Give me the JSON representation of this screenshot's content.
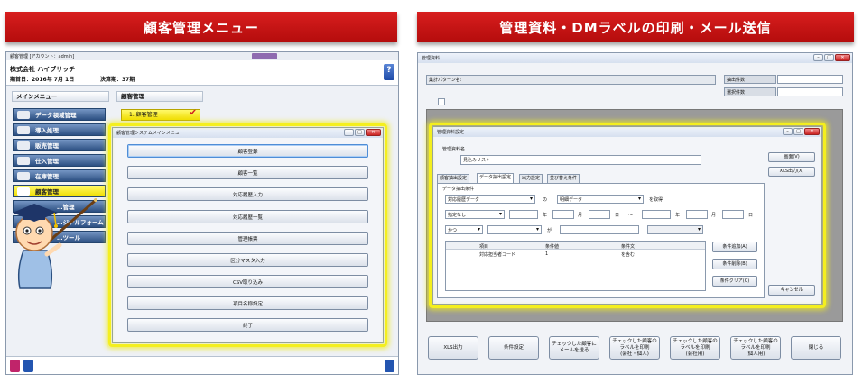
{
  "left": {
    "banner": "顧客管理メニュー",
    "window": {
      "title": "顧客管理 [アカウント：admin]",
      "company": "株式会社 ハイブリッチ",
      "period_start": "期首日：2016年 7月 1日",
      "fiscal_period": "決算期：37期",
      "help": "?",
      "main_menu_label": "メインメニュー",
      "sidebar": [
        {
          "label": "データ領域管理",
          "icon": "□"
        },
        {
          "label": "導入処理",
          "icon": "□"
        },
        {
          "label": "販売管理",
          "icon": "□"
        },
        {
          "label": "仕入管理",
          "icon": "□"
        },
        {
          "label": "在庫管理",
          "icon": "□"
        },
        {
          "label": "顧客管理",
          "icon": "□"
        },
        {
          "label": "…管理",
          "icon": ""
        },
        {
          "label": "…ジナルフォーム",
          "icon": ""
        },
        {
          "label": "…ツール",
          "icon": ""
        }
      ],
      "section_title": "顧客管理",
      "sub_item": "1. 顧客管理",
      "check": "✔"
    },
    "dialog": {
      "title": "顧客管理システムメインメニュー",
      "buttons": [
        "顧客登録",
        "顧客一覧",
        "対応履歴入力",
        "対応履歴一覧",
        "管理帳票",
        "区分マスタ入力",
        "CSV取り込み",
        "項目名称設定",
        "終了"
      ]
    }
  },
  "right": {
    "banner": "管理資料・DMラベルの印刷・メール送信",
    "window": {
      "title": "管理資料",
      "pattern_label": "集計パターン名:",
      "extract_label": "抽出件数",
      "select_label": "選択件数"
    },
    "dialog": {
      "title": "管理資料設定",
      "name_label": "管理資料名",
      "name_value": "見込みリスト",
      "tabs": [
        "顧客抽出設定",
        "データ抽出設定",
        "出力設定",
        "並び替え条件"
      ],
      "active_tab": 1,
      "group_label": "データ抽出条件",
      "sel1": "対応履歴データ",
      "no": "の",
      "sel2": "明細データ",
      "wo_get": "を取得",
      "sel3": "指定なし",
      "date_labels": [
        "年",
        "月",
        "日",
        "～",
        "年",
        "月",
        "日"
      ],
      "and_sel": "かつ",
      "ga": "が",
      "table_headers": [
        "項目",
        "条件値",
        "条件文"
      ],
      "table_rows": [
        [
          "対応担当者コード",
          "1",
          "を含む"
        ]
      ],
      "side_buttons": [
        "条件追加(A)",
        "条件削除(B)",
        "条件クリア(C)"
      ],
      "screen_btn": "画面(V)",
      "xls_btn": "XLS出力(X)",
      "cancel_btn": "キャンセル"
    },
    "bottom_buttons": [
      "XLS出力",
      "条件設定",
      "チェックした顧客に\nメールを送る",
      "チェックした顧客の\nラベルを印刷\n(会社・個人)",
      "チェックした顧客の\nラベルを印刷\n(会社用)",
      "チェックした顧客の\nラベルを印刷\n(個人用)",
      "閉じる"
    ]
  }
}
